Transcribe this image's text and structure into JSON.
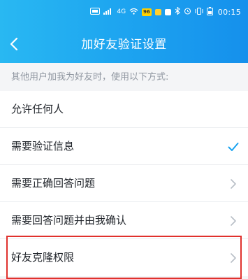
{
  "status_bar": {
    "time": "00:15",
    "badge_text": "96",
    "signal_text": "4G",
    "icons": [
      "sim-icon",
      "signal-icon",
      "wifi-icon",
      "app-badge-icon",
      "notification-icon",
      "bluetooth-icon",
      "alarm-icon",
      "vibrate-icon",
      "battery-icon"
    ]
  },
  "nav": {
    "back_icon": "chevron-left-icon",
    "title": "加好友验证设置"
  },
  "section_hint": "其他用户加我为好友时，使用以下方式:",
  "options": [
    {
      "label": "允许任何人",
      "indicator": "none"
    },
    {
      "label": "需要验证信息",
      "indicator": "check-icon"
    },
    {
      "label": "需要正确回答问题",
      "indicator": "chevron-right-icon"
    },
    {
      "label": "需要回答问题并由我确认",
      "indicator": "chevron-right-icon"
    },
    {
      "label": "好友克隆权限",
      "indicator": "chevron-right-icon"
    }
  ],
  "colors": {
    "header_start": "#29b8f2",
    "header_end": "#1590ec",
    "accent": "#1aa3f0",
    "chevron": "#b8bec6",
    "highlight": "#e0312d"
  }
}
